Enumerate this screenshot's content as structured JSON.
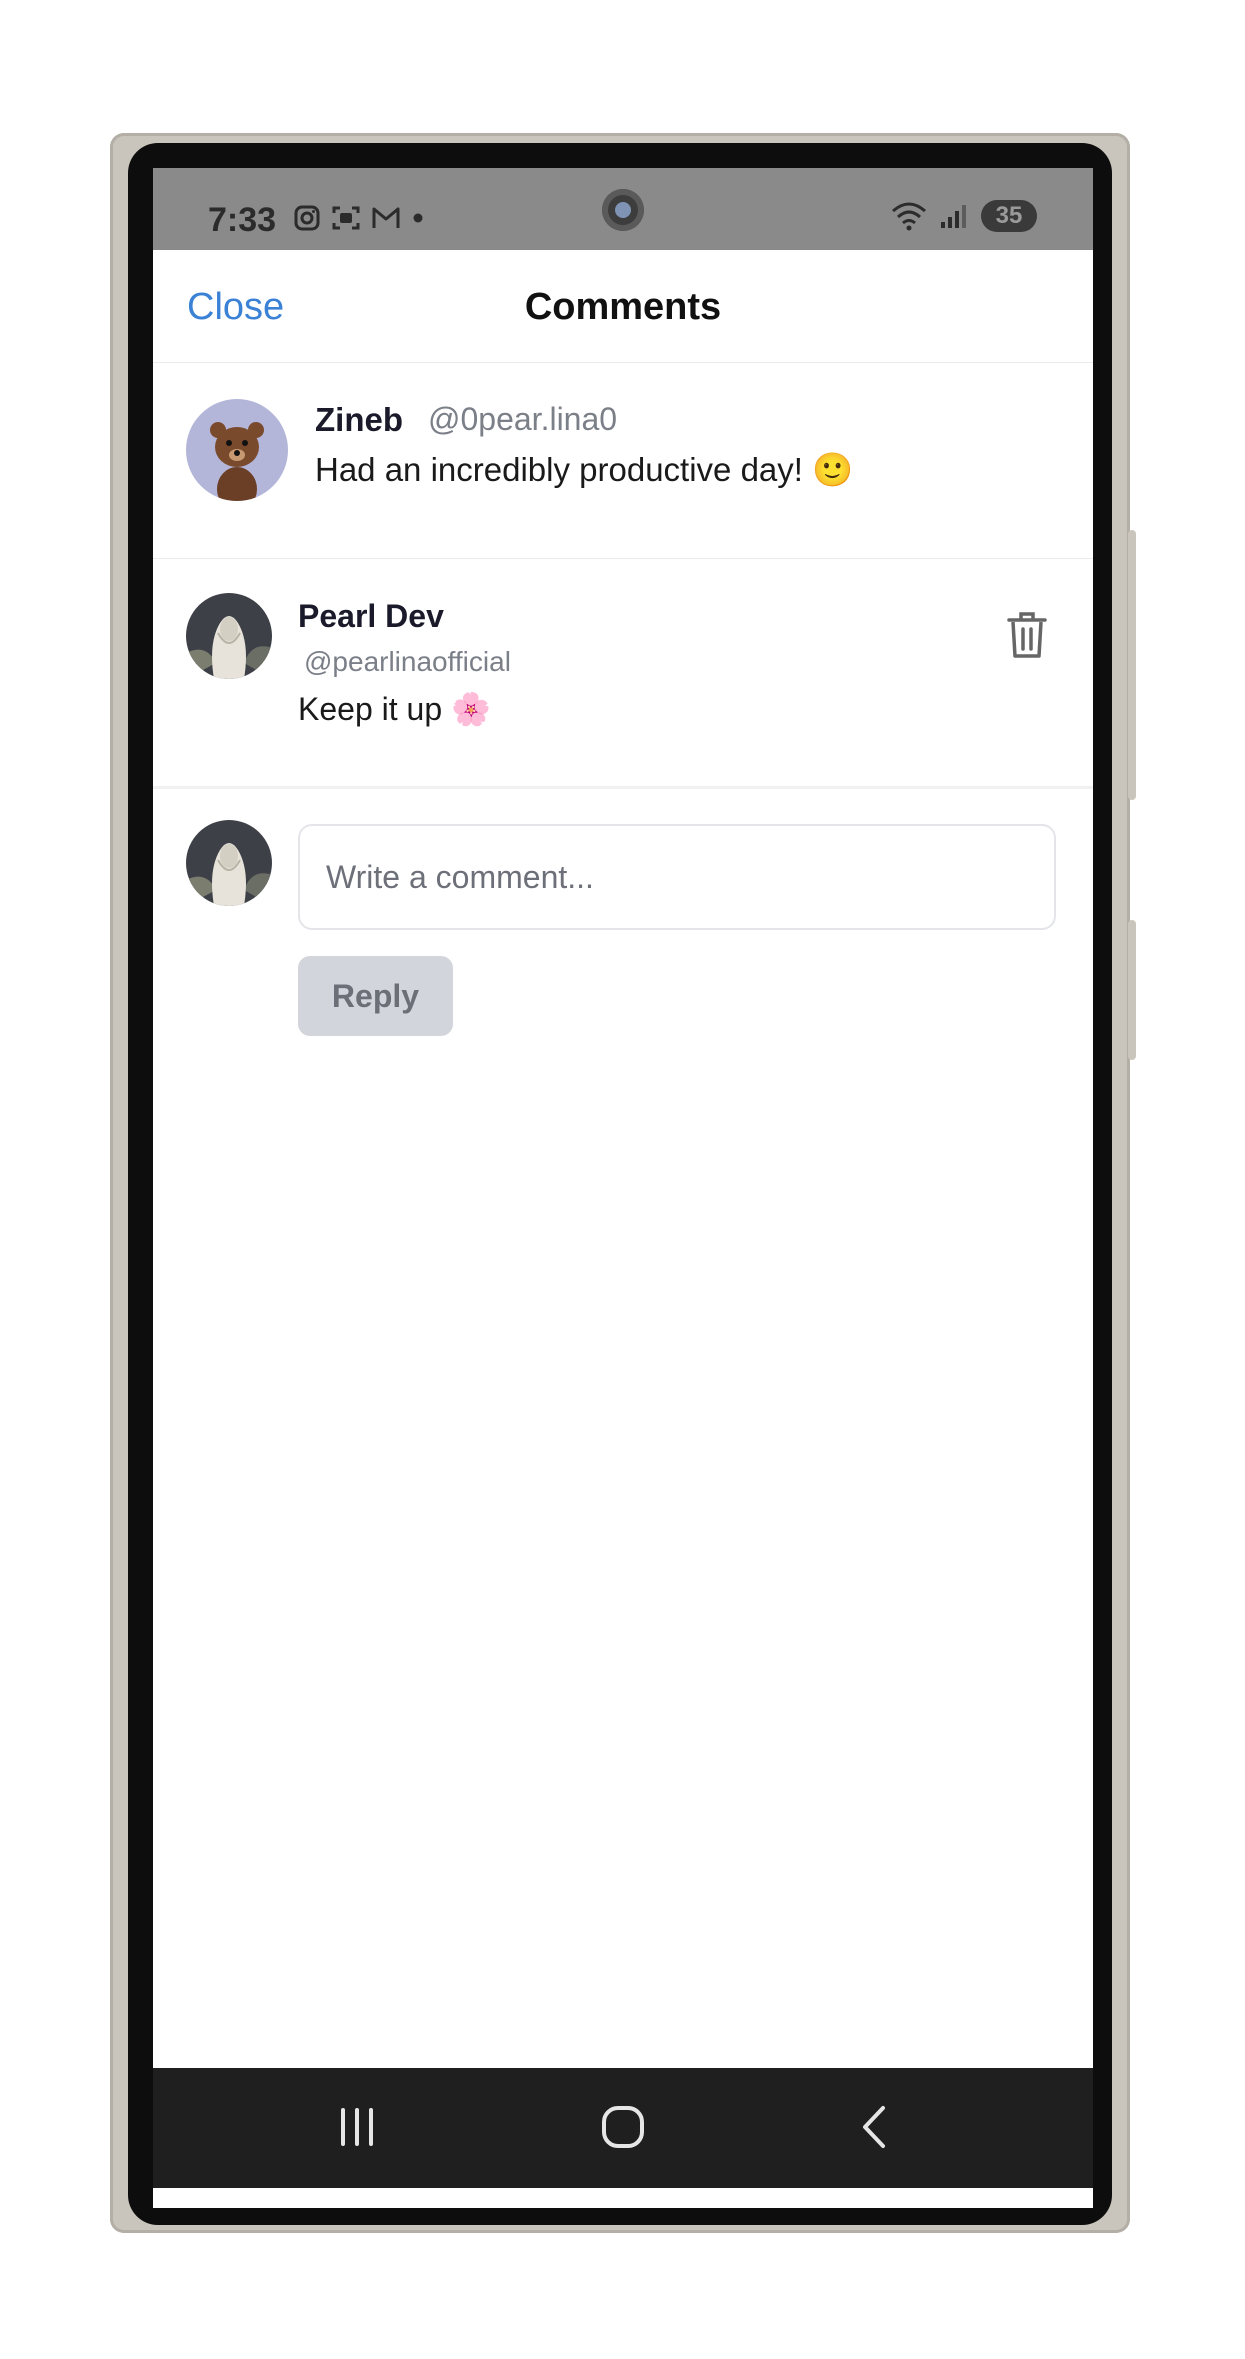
{
  "status_bar": {
    "time": "7:33",
    "left_icons": [
      "instagram-icon",
      "screenshot-icon",
      "gmail-icon",
      "dot-icon"
    ],
    "right_icons": [
      "wifi-icon",
      "signal-icon"
    ],
    "battery": "35"
  },
  "header": {
    "close_label": "Close",
    "title": "Comments"
  },
  "post": {
    "author_name": "Zineb",
    "author_handle": "@0pear.lina0",
    "text": "Had an incredibly productive day! 🙂"
  },
  "comments": [
    {
      "author_name": "Pearl Dev",
      "author_handle": "@pearlinaofficial",
      "text": "Keep it up 🌸"
    }
  ],
  "compose": {
    "placeholder": "Write a comment...",
    "reply_label": "Reply"
  },
  "nav": {
    "icons": [
      "recents-icon",
      "home-icon",
      "back-icon"
    ]
  },
  "colors": {
    "accent": "#3b82d6",
    "reply_button_bg": "#d2d5dc",
    "nav_bar": "#1f1f1f",
    "status_bar": "#8a8a8a"
  }
}
